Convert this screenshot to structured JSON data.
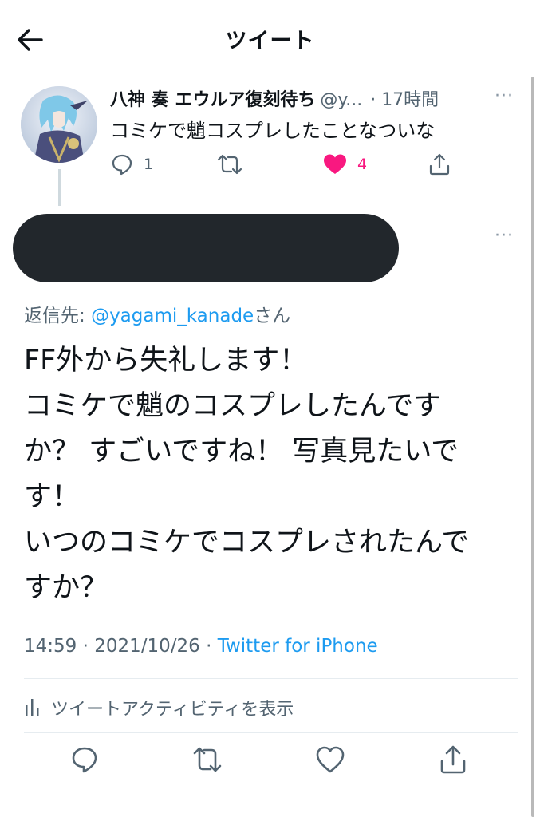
{
  "header": {
    "title": "ツイート",
    "back_icon": "arrow-left-icon"
  },
  "parent_tweet": {
    "name": "八神 奏 エウルア復刻待ち",
    "handle": "@y...",
    "time": "· 17時間",
    "more": "···",
    "text": "コミケで魈コスプレしたことなついな",
    "reply_count": "1",
    "retweet_count": "",
    "like_count": "4",
    "like_color": "#f91880"
  },
  "reply": {
    "more": "···",
    "reply_to_prefix": "返信先: ",
    "reply_to_mention": "@yagami_kanade",
    "reply_to_suffix": "さん",
    "text_lines": [
      "FF外から失礼します！",
      "コミケで魈のコスプレしたんです",
      "か？ すごいですね！ 写真見たいで",
      "す！",
      "いつのコミケでコスプレされたんで",
      "すか？"
    ],
    "time": "14:59 · 2021/10/26 · ",
    "client": "Twitter for iPhone",
    "activity_label": "ツイートアクティビティを表示"
  },
  "colors": {
    "accent": "#1d9bf0",
    "secondary_text": "#536471",
    "redaction": "#22272c"
  }
}
